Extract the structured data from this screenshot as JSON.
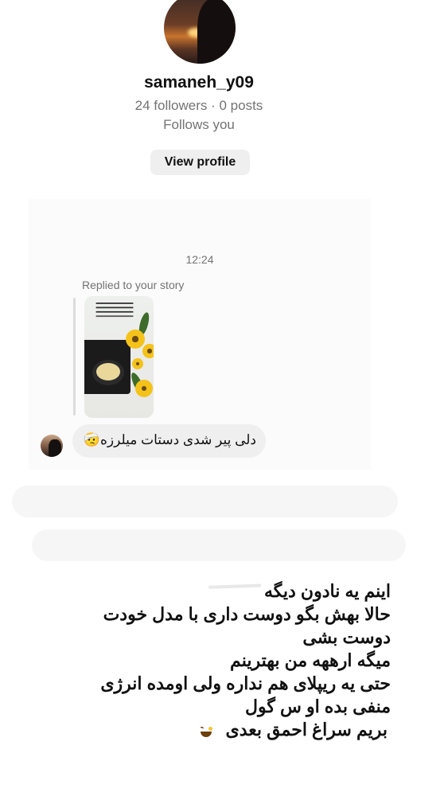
{
  "profile": {
    "username": "samaneh_y09",
    "followers_line": "24 followers · 0 posts",
    "follows_you": "Follows you",
    "view_profile_label": "View profile"
  },
  "chat": {
    "timestamp": "12:24",
    "replied_label": "Replied to your story",
    "message": "دلی پیر شدی دستات میلرزه🤕"
  },
  "caption": {
    "lines": [
      "اینم یه   نادون دیگه",
      "حالا بهش بگو دوست داری با مدل خودت",
      "دوست بشی",
      "میگه ارههه من بهترینم",
      "حتی یه ریپلای هم نداره ولی اومده انرژی",
      "منفی بده او س گول",
      "بریم سراغ احمق بعدی"
    ]
  },
  "icons": {
    "laugh_emoji": "face-with-tears-of-joy-icon"
  }
}
